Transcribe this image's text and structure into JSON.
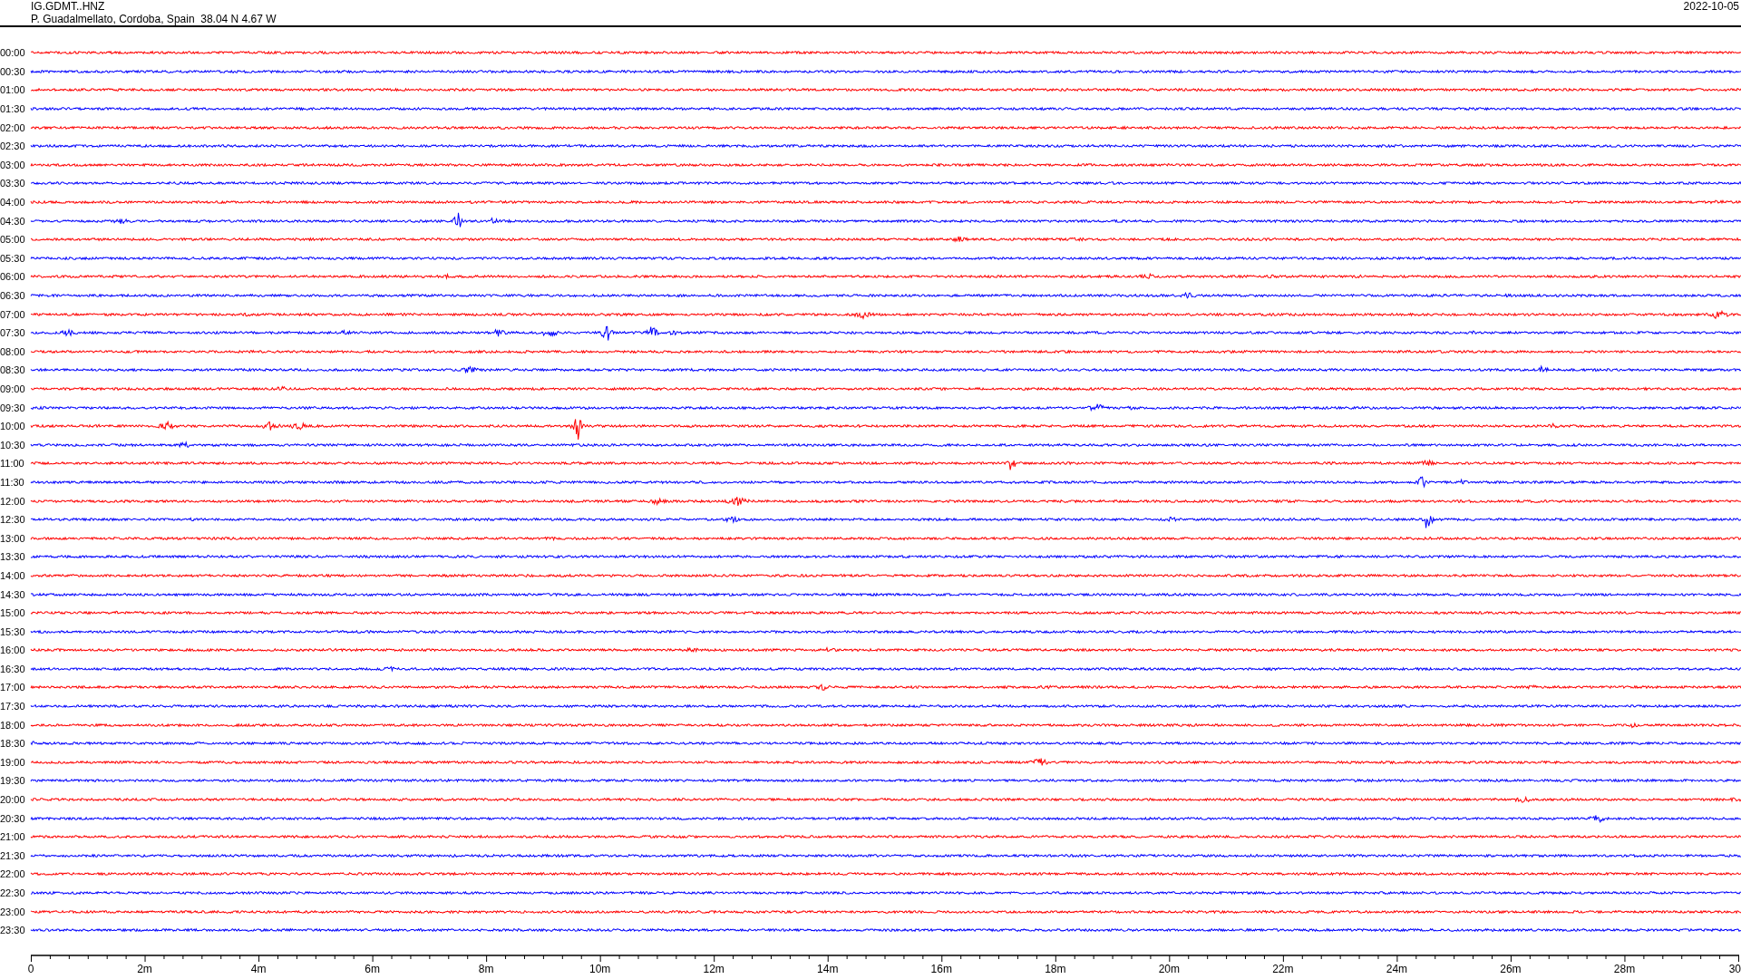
{
  "header": {
    "station": "IG.GDMT..HNZ",
    "location": "P. Guadalmellato, Cordoba, Spain  38.04 N 4.67 W",
    "date": "2022-10-05"
  },
  "rows": [
    {
      "time": "00:00",
      "color": "#ff0000"
    },
    {
      "time": "00:30",
      "color": "#0000ff"
    },
    {
      "time": "01:00",
      "color": "#ff0000"
    },
    {
      "time": "01:30",
      "color": "#0000ff"
    },
    {
      "time": "02:00",
      "color": "#ff0000"
    },
    {
      "time": "02:30",
      "color": "#0000ff"
    },
    {
      "time": "03:00",
      "color": "#ff0000"
    },
    {
      "time": "03:30",
      "color": "#0000ff"
    },
    {
      "time": "04:00",
      "color": "#ff0000"
    },
    {
      "time": "04:30",
      "color": "#0000ff"
    },
    {
      "time": "05:00",
      "color": "#ff0000"
    },
    {
      "time": "05:30",
      "color": "#0000ff"
    },
    {
      "time": "06:00",
      "color": "#ff0000"
    },
    {
      "time": "06:30",
      "color": "#0000ff"
    },
    {
      "time": "07:00",
      "color": "#ff0000"
    },
    {
      "time": "07:30",
      "color": "#0000ff"
    },
    {
      "time": "08:00",
      "color": "#ff0000"
    },
    {
      "time": "08:30",
      "color": "#0000ff"
    },
    {
      "time": "09:00",
      "color": "#ff0000"
    },
    {
      "time": "09:30",
      "color": "#0000ff"
    },
    {
      "time": "10:00",
      "color": "#ff0000"
    },
    {
      "time": "10:30",
      "color": "#0000ff"
    },
    {
      "time": "11:00",
      "color": "#ff0000"
    },
    {
      "time": "11:30",
      "color": "#0000ff"
    },
    {
      "time": "12:00",
      "color": "#ff0000"
    },
    {
      "time": "12:30",
      "color": "#0000ff"
    },
    {
      "time": "13:00",
      "color": "#ff0000"
    },
    {
      "time": "13:30",
      "color": "#0000ff"
    },
    {
      "time": "14:00",
      "color": "#ff0000"
    },
    {
      "time": "14:30",
      "color": "#0000ff"
    },
    {
      "time": "15:00",
      "color": "#ff0000"
    },
    {
      "time": "15:30",
      "color": "#0000ff"
    },
    {
      "time": "16:00",
      "color": "#ff0000"
    },
    {
      "time": "16:30",
      "color": "#0000ff"
    },
    {
      "time": "17:00",
      "color": "#ff0000"
    },
    {
      "time": "17:30",
      "color": "#0000ff"
    },
    {
      "time": "18:00",
      "color": "#ff0000"
    },
    {
      "time": "18:30",
      "color": "#0000ff"
    },
    {
      "time": "19:00",
      "color": "#ff0000"
    },
    {
      "time": "19:30",
      "color": "#0000ff"
    },
    {
      "time": "20:00",
      "color": "#ff0000"
    },
    {
      "time": "20:30",
      "color": "#0000ff"
    },
    {
      "time": "21:00",
      "color": "#ff0000"
    },
    {
      "time": "21:30",
      "color": "#0000ff"
    },
    {
      "time": "22:00",
      "color": "#ff0000"
    },
    {
      "time": "22:30",
      "color": "#0000ff"
    },
    {
      "time": "23:00",
      "color": "#ff0000"
    },
    {
      "time": "23:30",
      "color": "#0000ff"
    }
  ],
  "axis": {
    "labels": [
      "0",
      "2m",
      "4m",
      "6m",
      "8m",
      "10m",
      "12m",
      "14m",
      "16m",
      "18m",
      "20m",
      "22m",
      "24m",
      "26m",
      "28m",
      "30"
    ]
  }
}
